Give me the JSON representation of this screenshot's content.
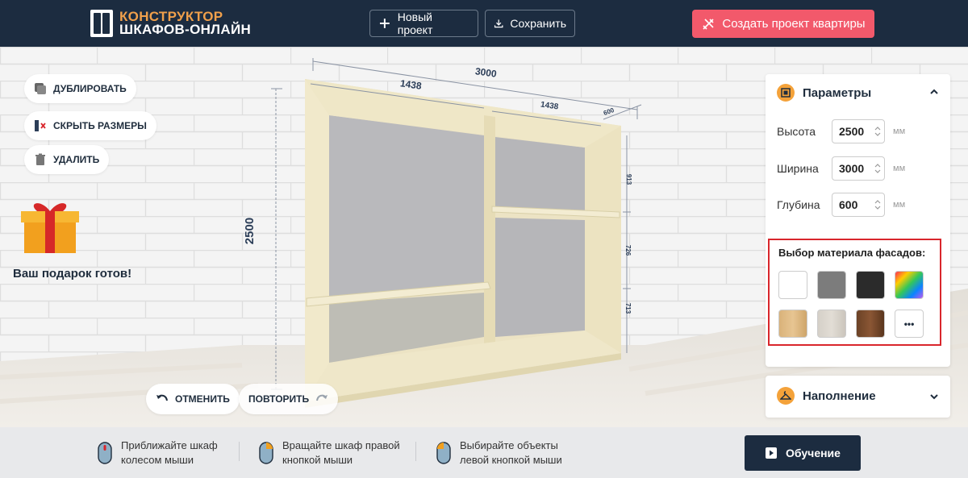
{
  "header": {
    "logo_line1": "КОНСТРУКТОР",
    "logo_line2": "ШКАФОВ-ОНЛАЙН",
    "new_project": "Новый проект",
    "save": "Сохранить",
    "create_apartment": "Создать проект квартиры",
    "accent": "#f2596b",
    "bar_color": "#1c2c40"
  },
  "toolbar": {
    "duplicate": "ДУБЛИРОВАТЬ",
    "hide_sizes": "СКРЫТЬ РАЗМЕРЫ",
    "delete": "УДАЛИТЬ",
    "undo": "ОТМЕНИТЬ",
    "redo": "ПОВТОРИТЬ"
  },
  "gift": {
    "text": "Ваш подарок готов!"
  },
  "dimensions": {
    "total_width": "3000",
    "left_section": "1438",
    "right_section": "1438",
    "depth": "600",
    "height": "2500",
    "right_shelf_1": "913",
    "right_shelf_2": "726",
    "right_shelf_3": "713"
  },
  "params": {
    "title": "Параметры",
    "height_label": "Высота",
    "height_value": "2500",
    "width_label": "Ширина",
    "width_value": "3000",
    "depth_label": "Глубина",
    "depth_value": "600",
    "unit": "мм"
  },
  "material": {
    "title": "Выбор материала фасадов:",
    "swatches": [
      "white",
      "gray",
      "black",
      "rainbow",
      "light-oak",
      "light-gray-wood",
      "walnut",
      "more"
    ],
    "more_label": "•••"
  },
  "filling": {
    "title": "Наполнение"
  },
  "footer": {
    "hint1_line1": "Приближайте шкаф",
    "hint1_line2": "колесом мыши",
    "hint2_line1": "Вращайте шкаф правой",
    "hint2_line2": "кнопкой мыши",
    "hint3_line1": "Выбирайте объекты",
    "hint3_line2": "левой кнопкой мыши",
    "learn": "Обучение"
  }
}
